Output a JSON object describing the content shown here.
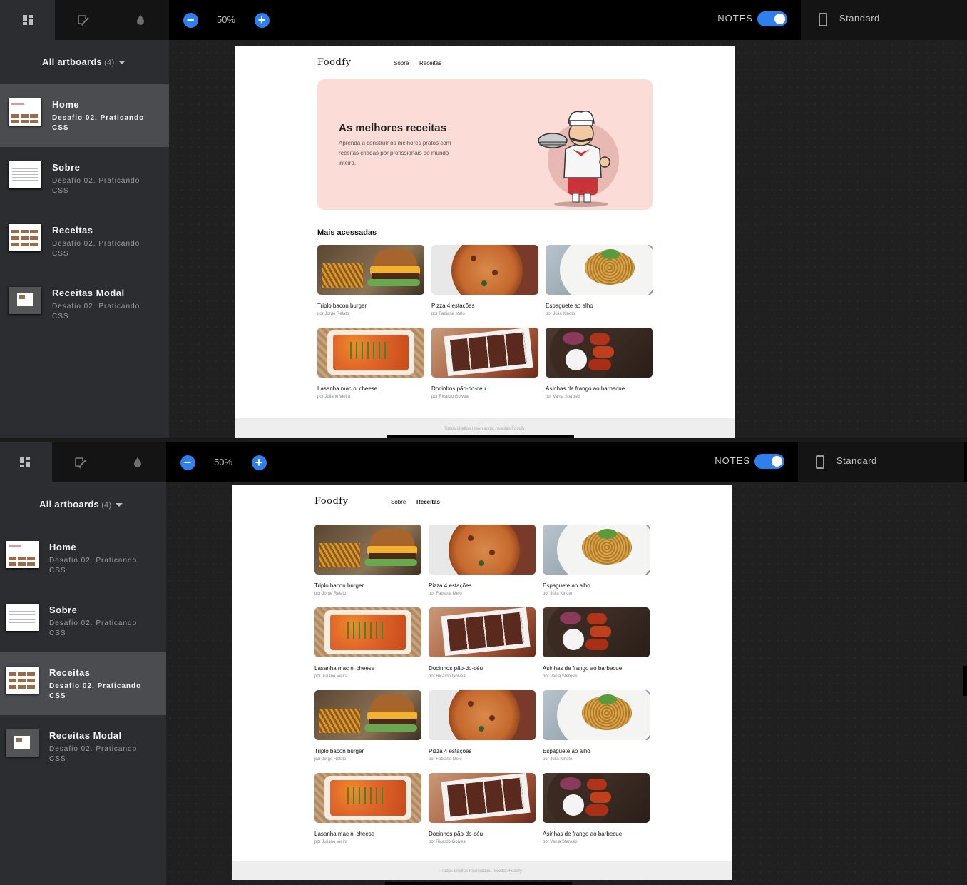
{
  "toolbar": {
    "zoom": "50%",
    "notes_label": "NOTES",
    "device_label": "Standard"
  },
  "sidebar": {
    "header": "All artboards",
    "count": "(4)",
    "items": [
      {
        "title": "Home",
        "subtitle": "Desafio 02. Praticando CSS"
      },
      {
        "title": "Sobre",
        "subtitle": "Desafio 02. Praticando CSS"
      },
      {
        "title": "Receitas",
        "subtitle": "Desafio 02. Praticando CSS"
      },
      {
        "title": "Receitas Modal",
        "subtitle": "Desafio 02. Praticando CSS"
      }
    ]
  },
  "site": {
    "brand": "Foodfy",
    "nav": [
      "Sobre",
      "Receitas"
    ],
    "hero_title": "As melhores receitas",
    "hero_text": "Aprenda a construir os melhores pratos com receitas criadas por profissionais do mundo inteiro.",
    "section_title": "Mais acessadas",
    "footer": "Todos direitos reservados, receitas Foodfy.",
    "recipes": [
      {
        "title": "Triplo bacon burger",
        "author": "por Jorge Relato",
        "kind": "burger"
      },
      {
        "title": "Pizza 4 estações",
        "author": "por Fabiana Melo",
        "kind": "pizza"
      },
      {
        "title": "Espaguete ao alho",
        "author": "por Júlia Kinoto",
        "kind": "pasta"
      },
      {
        "title": "Lasanha mac n' cheese",
        "author": "por Juliano Vieira",
        "kind": "lasagna"
      },
      {
        "title": "Docinhos pão-do-céu",
        "author": "por Ricardo Golvea",
        "kind": "sweets"
      },
      {
        "title": "Asinhas de frango ao barbecue",
        "author": "por Vania Steroski",
        "kind": "wings"
      }
    ]
  },
  "colors": {
    "accent": "#2f80ed",
    "hero_bg": "#fbdcd6",
    "sidebar_bg": "#2b2d30",
    "sidebar_active": "#4a4c50"
  }
}
